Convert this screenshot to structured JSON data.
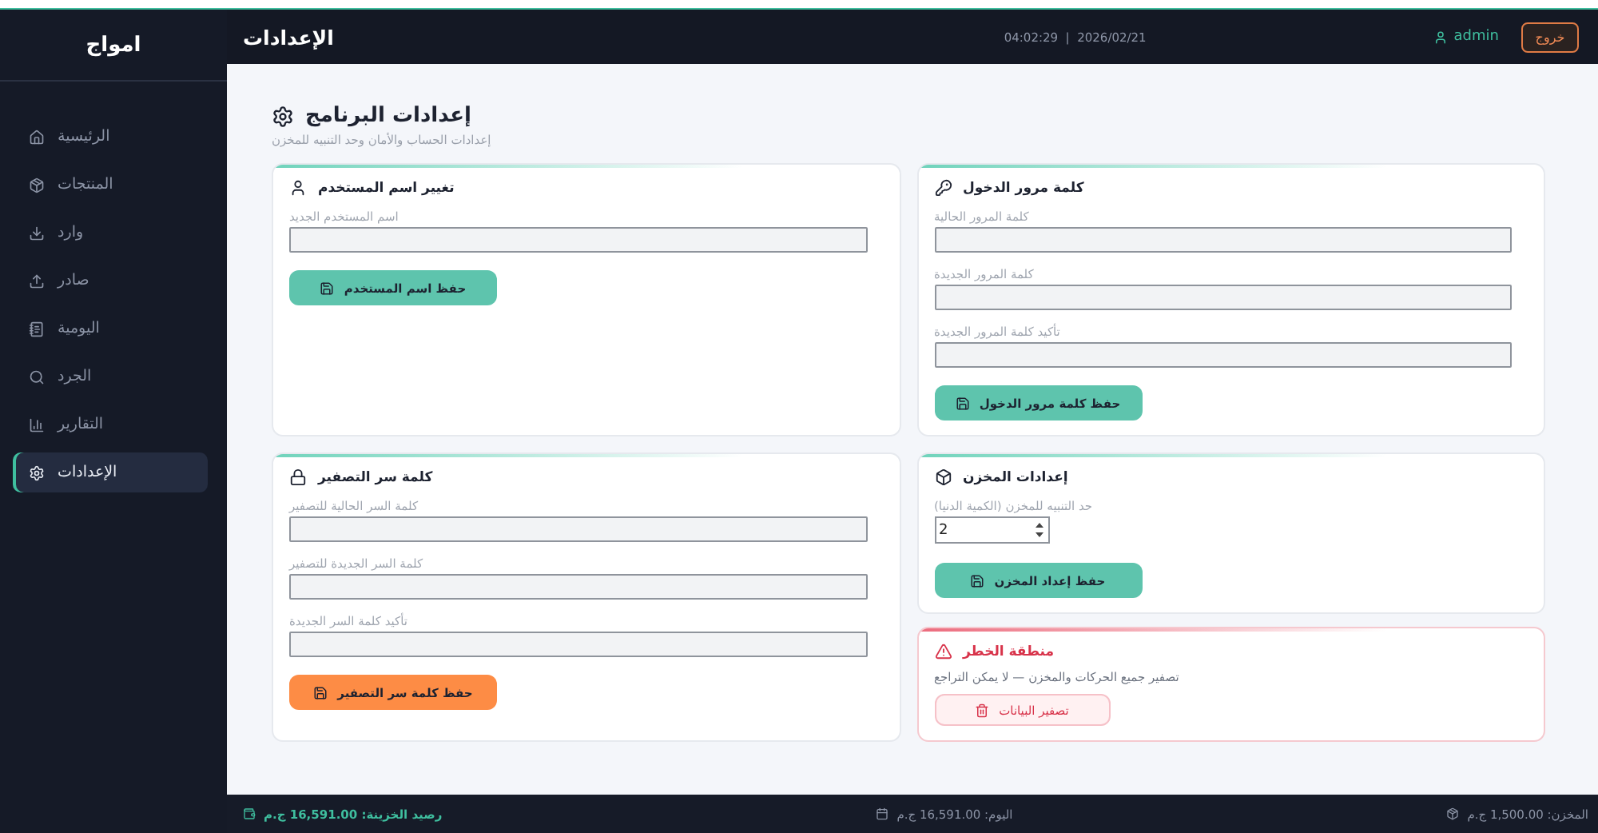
{
  "header": {
    "brand": "امواج",
    "title": "الإعدادات",
    "datetime": "04:02:29  |  2026/02/21",
    "user": "admin",
    "logout": "خروج"
  },
  "sidebar": {
    "items": [
      {
        "label": "الرئيسية",
        "selected": false
      },
      {
        "label": "المنتجات",
        "selected": false
      },
      {
        "label": "وارد",
        "selected": false
      },
      {
        "label": "صادر",
        "selected": false
      },
      {
        "label": "اليومية",
        "selected": false
      },
      {
        "label": "الجرد",
        "selected": false
      },
      {
        "label": "التقارير",
        "selected": false
      },
      {
        "label": "الإعدادات",
        "selected": true
      }
    ]
  },
  "page": {
    "title": "إعدادات البرنامج",
    "subtitle": "إعدادات الحساب والأمان وحد التنبيه للمخزن"
  },
  "rows": [
    {
      "cells": [
        {
          "cards": [
            {
              "kind": "login_password",
              "title": "كلمة مرور الدخول",
              "fields": [
                {
                  "kind": "text",
                  "label": "كلمة المرور الحالية"
                },
                {
                  "kind": "text",
                  "label": "كلمة المرور الجديدة"
                },
                {
                  "kind": "text",
                  "label": "تأكيد كلمة المرور الجديدة"
                }
              ],
              "button": {
                "label": "حفظ كلمة مرور الدخول",
                "kind": "save"
              }
            }
          ]
        },
        {
          "cards": [
            {
              "kind": "username",
              "title": "تغيير اسم المستخدم",
              "fields": [
                {
                  "kind": "text",
                  "label": "اسم المستخدم الجديد"
                }
              ],
              "button": {
                "label": "حفظ اسم المستخدم",
                "kind": "save"
              }
            }
          ]
        }
      ]
    },
    {
      "cells": [
        {
          "cards": [
            {
              "kind": "warehouse",
              "title": "إعدادات المخزن",
              "fields": [
                {
                  "kind": "number",
                  "label": "حد التنبيه للمخزن (الكمية الدنيا)",
                  "value": "2"
                }
              ],
              "button": {
                "label": "حفظ إعداد المخزن",
                "kind": "save"
              }
            },
            {
              "kind": "danger",
              "title": "منطقة الخطر",
              "text": "تصفير جميع الحركات والمخزن — لا يمكن التراجع",
              "button": {
                "label": "تصفير البيانات",
                "kind": "danger"
              }
            }
          ]
        },
        {
          "cards": [
            {
              "kind": "reset_password",
              "title": "كلمة سر التصفير",
              "fields": [
                {
                  "kind": "text",
                  "label": "كلمة السر الحالية للتصفير"
                },
                {
                  "kind": "text",
                  "label": "كلمة السر الجديدة للتصفير"
                },
                {
                  "kind": "text",
                  "label": "تأكيد كلمة السر الجديدة"
                }
              ],
              "button": {
                "label": "حفظ كلمة سر التصفير",
                "kind": "warning"
              }
            }
          ]
        }
      ]
    }
  ],
  "footer": {
    "items": [
      {
        "kind": "stock",
        "text": "المخزن: 1,500.00 ج.م"
      },
      {
        "kind": "today",
        "text": "اليوم: 16,591.00 ج.م"
      },
      {
        "kind": "treasury",
        "text": "رصيد الخزينة: 16,591.00 ج.م"
      }
    ]
  }
}
